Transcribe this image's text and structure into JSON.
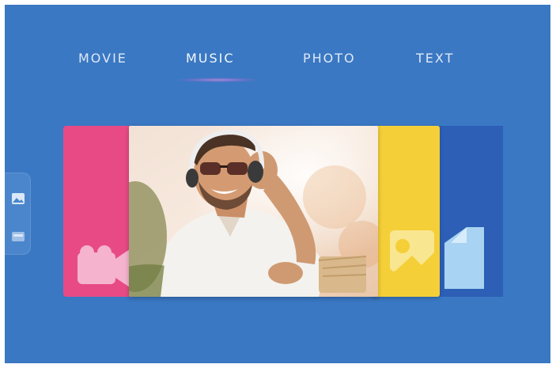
{
  "tabs": [
    {
      "label": "MOVIE"
    },
    {
      "label": "MUSIC",
      "active": true
    },
    {
      "label": "PHOTO"
    },
    {
      "label": "TEXT"
    }
  ],
  "cards": {
    "movie": {
      "icon": "movie-camera-icon",
      "color": "#e84a86"
    },
    "music": {
      "image": "man-with-headphones-photo"
    },
    "photo": {
      "icon": "picture-icon",
      "color": "#f4cf38"
    },
    "text": {
      "icon": "document-icon",
      "color": "#2c5fb5"
    }
  },
  "side_panel": {
    "icons": [
      "picture-icon",
      "folder-icon"
    ]
  },
  "colors": {
    "background": "#3a78c3",
    "tab_text": "#dfe8f6",
    "highlight": "#9b8ad8"
  }
}
